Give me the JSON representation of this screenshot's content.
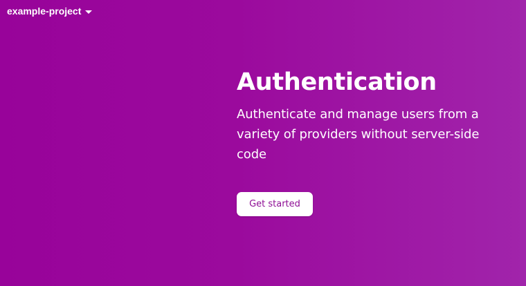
{
  "header": {
    "project_name": "example-project",
    "project_dropdown_icon": "caret-down-icon"
  },
  "hero": {
    "title": "Authentication",
    "subtitle": "Authenticate and manage users from a variety of providers without server-side code",
    "cta_label": "Get started"
  },
  "colors": {
    "background_start": "#98039a",
    "background_end": "#a124ab",
    "text": "#ffffff",
    "button_background": "#ffffff",
    "button_text": "#8e0e94"
  }
}
